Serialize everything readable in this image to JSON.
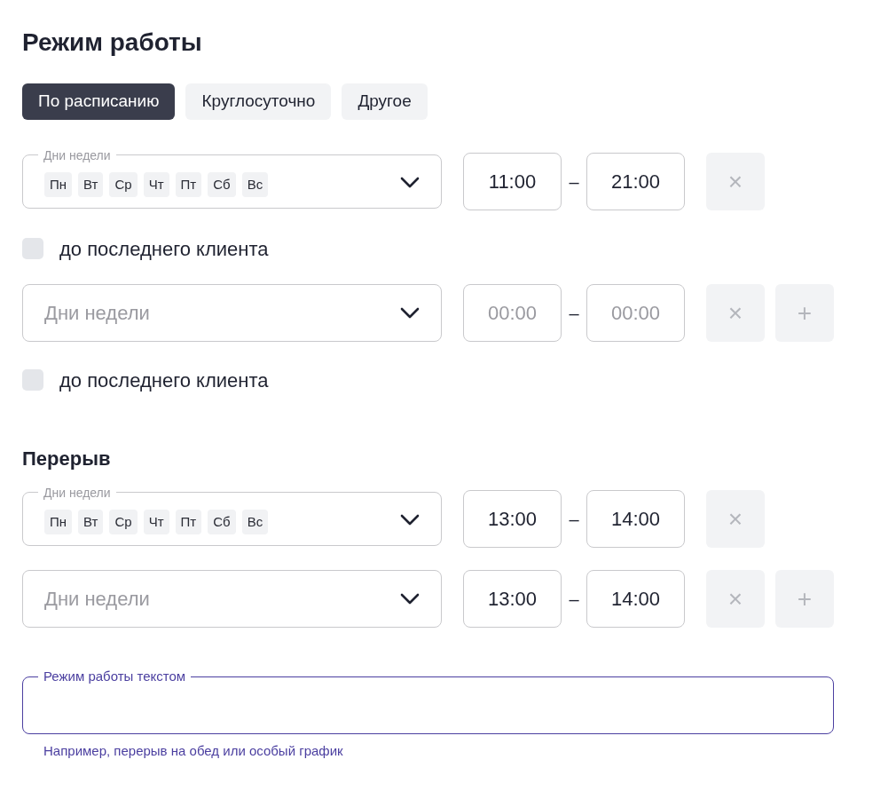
{
  "title": "Режим работы",
  "modes": [
    {
      "label": "По расписанию",
      "selected": true
    },
    {
      "label": "Круглосуточно",
      "selected": false
    },
    {
      "label": "Другое",
      "selected": false
    }
  ],
  "schedule": [
    {
      "days_label": "Дни недели",
      "days": [
        "Пн",
        "Вт",
        "Ср",
        "Чт",
        "Пт",
        "Сб",
        "Вс"
      ],
      "from": {
        "value": "11:00"
      },
      "dash": "–",
      "to": {
        "value": "21:00"
      },
      "remove": "×",
      "last_client": {
        "label": "до последнего клиента",
        "checked": false
      }
    },
    {
      "days_placeholder": "Дни недели",
      "from": {
        "placeholder": "00:00"
      },
      "dash": "–",
      "to": {
        "placeholder": "00:00"
      },
      "remove": "×",
      "add": "+",
      "last_client": {
        "label": "до последнего клиента",
        "checked": false
      }
    }
  ],
  "break": {
    "title": "Перерыв",
    "rows": [
      {
        "days_label": "Дни недели",
        "days": [
          "Пн",
          "Вт",
          "Ср",
          "Чт",
          "Пт",
          "Сб",
          "Вс"
        ],
        "from": {
          "value": "13:00"
        },
        "dash": "–",
        "to": {
          "value": "14:00"
        },
        "remove": "×"
      },
      {
        "days_placeholder": "Дни недели",
        "from": {
          "value": "13:00"
        },
        "dash": "–",
        "to": {
          "value": "14:00"
        },
        "remove": "×",
        "add": "+"
      }
    ]
  },
  "text_field": {
    "label": "Режим работы текстом",
    "hint": "Например, перерыв на обед или особый график"
  }
}
